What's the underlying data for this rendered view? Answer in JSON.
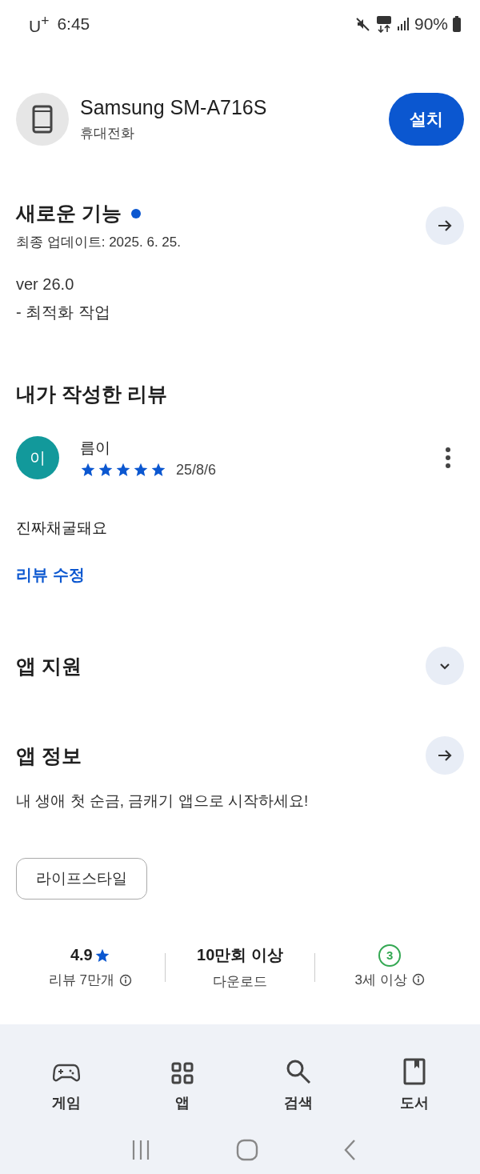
{
  "status_bar": {
    "carrier": "U$^{+}$",
    "time": "6:45",
    "battery": "90%"
  },
  "device": {
    "name": "Samsung SM-A716S",
    "type": "휴대전화",
    "button": "설치"
  },
  "whats_new": {
    "title": "새로운 기능",
    "new": true,
    "updated": "최종 업데이트: 2025. 6. 25.",
    "notes": [
      "ver 26.0",
      "- 최적화 작업"
    ]
  },
  "my_review": {
    "title": "내가 작성한 리뷰",
    "avatar": "이",
    "author": "름이",
    "stars": 5,
    "date": "25/8/6",
    "text": "진짜채굴돼요",
    "edit_link": "리뷰 수정"
  },
  "app_support": {
    "title": "앱 지원",
    "expanded": false
  },
  "app_info": {
    "title": "앱 정보",
    "description": "내 생애 첫 순금, 금캐기 앱으로 시작하세요!",
    "tag": "라이프스타일"
  },
  "stats": [
    {
      "kind": "rating",
      "value": "4.9",
      "label": "리뷰 7만개",
      "info": true
    },
    {
      "kind": "plain",
      "value": "10만회 이상",
      "label": "다운로드"
    },
    {
      "kind": "age",
      "value": "3",
      "label": "3세 이상",
      "info": true
    }
  ],
  "bottom_nav": [
    {
      "kind": "games",
      "label": "게임"
    },
    {
      "kind": "apps",
      "label": "앱"
    },
    {
      "kind": "search",
      "label": "검색"
    },
    {
      "kind": "books",
      "label": "도서"
    }
  ]
}
